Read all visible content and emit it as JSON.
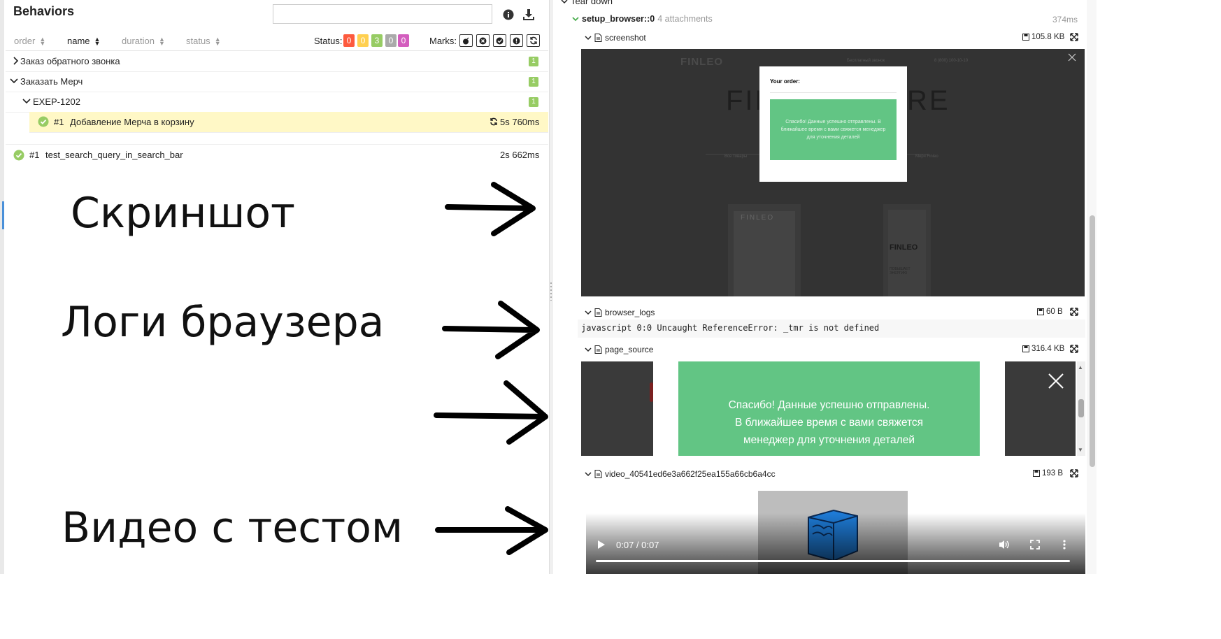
{
  "left": {
    "title": "Behaviors",
    "search_placeholder": "",
    "sort": {
      "order": "order",
      "name": "name",
      "duration": "duration",
      "status": "status"
    },
    "status_label": "Status:",
    "status_counts": [
      {
        "value": "0",
        "color": "#fd5a3e"
      },
      {
        "value": "0",
        "color": "#ffd050"
      },
      {
        "value": "3",
        "color": "#97cc64"
      },
      {
        "value": "0",
        "color": "#aaaaaa"
      },
      {
        "value": "0",
        "color": "#d35ebe"
      }
    ],
    "marks_label": "Marks:",
    "tree": {
      "group1": {
        "label": "Заказ обратного звонка",
        "count": "1"
      },
      "group2": {
        "label": "Заказать Мерч",
        "count": "1"
      },
      "sub": {
        "label": "EXEP-1202",
        "count": "1"
      },
      "test1": {
        "num": "#1",
        "name": "Добавление Мерча в корзину",
        "duration": "5s 760ms"
      },
      "test2": {
        "num": "#1",
        "name": "test_search_query_in_search_bar",
        "duration": "2s 662ms"
      }
    },
    "annotations": {
      "screenshot": "Скриншот",
      "logs": "Логи браузера",
      "video": "Видео с тестом"
    }
  },
  "right": {
    "teardown": "Tear down",
    "step": {
      "name": "setup_browser::0",
      "attachments": "4 attachments",
      "duration": "374ms"
    },
    "screenshot": {
      "name": "screenshot",
      "size": "105.8 KB",
      "page": {
        "logo": "FINLEO",
        "nav_phone": "8 (800) 100-10-10",
        "nav_middle": "Бесплатный звонок",
        "big_left": "FIN",
        "big_right": "RE",
        "tab_all": "Все товары",
        "tab_other": "Мерч Finleo",
        "modal_title": "Your order:",
        "modal_msg": "Спасибо! Данные успешно отправлены. В ближайшее время с вами свяжется менеджер для уточнения деталей",
        "product_brand": "FINLEO",
        "product_brand2": "FINLEO",
        "product_text": "ПОВЫШАЕТ ЭНЕРГИЮ"
      }
    },
    "browser_logs": {
      "name": "browser_logs",
      "size": "60 B",
      "line": "javascript 0:0 Uncaught ReferenceError: _tmr is not defined"
    },
    "page_source": {
      "name": "page_source",
      "size": "316.4 KB",
      "msg1": "Спасибо! Данные успешно отправлены.",
      "msg2": "В ближайшее время с вами свяжется",
      "msg3": "менеджер для уточнения деталей"
    },
    "video": {
      "name": "video_40541ed6e3a662f25ea155a66cb6a4cc",
      "size": "193 B",
      "time": "0:07 / 0:07"
    }
  }
}
